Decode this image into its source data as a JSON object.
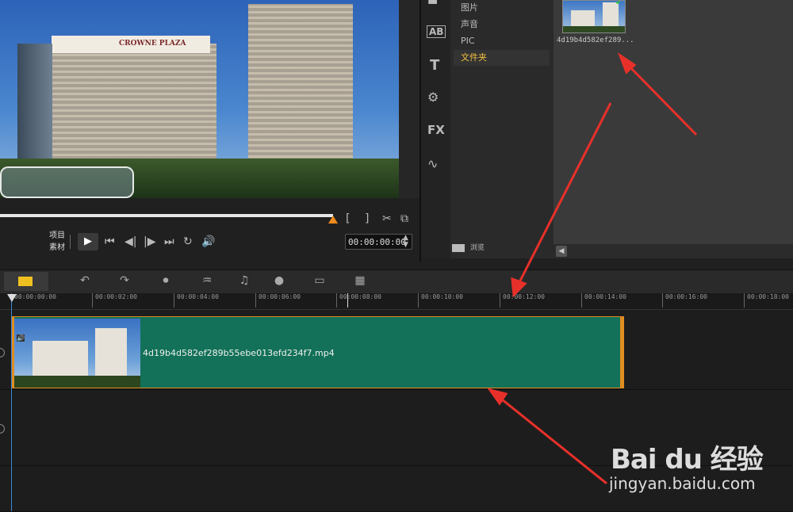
{
  "preview": {
    "hotel_sign": "CROWNE PLAZA",
    "mode_labels": [
      "项目",
      "素材"
    ],
    "timecode": "00:00:00:00",
    "mark_in": "[",
    "mark_out": "]"
  },
  "library": {
    "categories": [
      {
        "label": "图片",
        "active": false
      },
      {
        "label": "声音",
        "active": false
      },
      {
        "label": "PIC",
        "active": false
      },
      {
        "label": "文件夹",
        "active": true
      }
    ],
    "browse_label": "浏览",
    "media_items": [
      {
        "name": "4d19b4d582ef289..."
      }
    ],
    "toolbar_icons": [
      "media-icon",
      "title-ab-icon",
      "text-t-icon",
      "transition-icon",
      "fx-icon",
      "path-icon"
    ]
  },
  "timeline": {
    "toolbar_icons": [
      "storyboard-icon",
      "undo-icon",
      "redo-icon",
      "record-icon",
      "audio-mixer-icon",
      "auto-music-icon",
      "motion-icon",
      "subtitle-icon",
      "multi-view-icon"
    ],
    "ruler_ticks": [
      "00:00:00:00",
      "00:00:02:00",
      "00:00:04:00",
      "00:00:06:00",
      "00:00:08:00",
      "00:00:10:00",
      "00:00:12:00",
      "00:00:14:00",
      "00:00:16:00",
      "00:00:18:00"
    ],
    "clip": {
      "name": "4d19b4d582ef289b55ebe013efd234f7.mp4",
      "color": "#127158",
      "border_color": "#e08c20"
    }
  },
  "watermark": {
    "logo": "Bai du 经验",
    "url": "jingyan.baidu.com"
  },
  "colors": {
    "accent_orange": "#f08a1a",
    "arrow_red": "#e8302a",
    "playhead_blue": "#3a88d8"
  }
}
